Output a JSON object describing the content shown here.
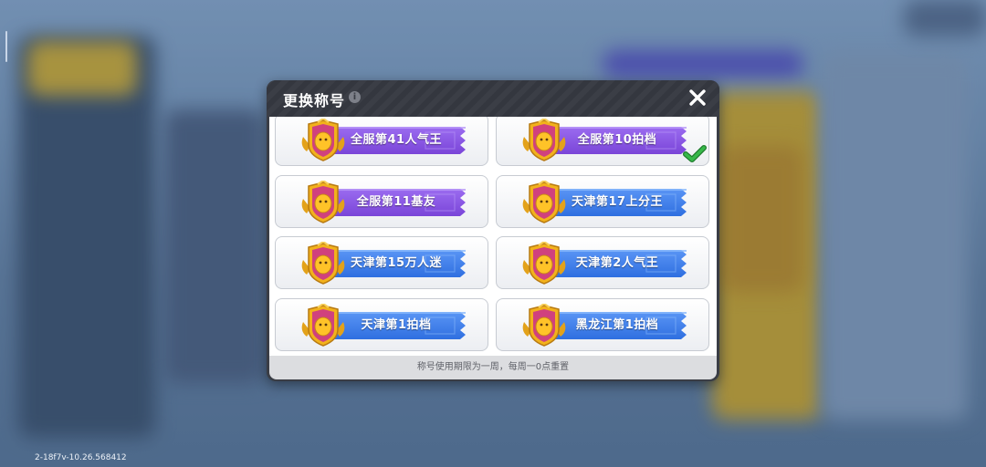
{
  "dialog": {
    "title": "更换称号",
    "footer_note": "称号使用期限为一周，每周一0点重置"
  },
  "titles": [
    {
      "label": "全服第41人气王",
      "style": "purple",
      "badge": "trophy-badge-icon",
      "selected": false
    },
    {
      "label": "全服第10拍档",
      "style": "purple",
      "badge": "ghost-duo-badge-icon",
      "selected": true
    },
    {
      "label": "全服第11基友",
      "style": "purple",
      "badge": "linked-rings-badge-icon",
      "selected": false
    },
    {
      "label": "天津第17上分王",
      "style": "blue",
      "badge": "crossed-swords-badge-icon",
      "selected": false
    },
    {
      "label": "天津第15万人迷",
      "style": "blue",
      "badge": "heart-fan-badge-icon",
      "selected": false
    },
    {
      "label": "天津第2人气王",
      "style": "blue",
      "badge": "trophy-badge-icon",
      "selected": false
    },
    {
      "label": "天津第1拍档",
      "style": "blue",
      "badge": "ghost-duo-badge-icon",
      "selected": false
    },
    {
      "label": "黑龙江第1拍档",
      "style": "blue",
      "badge": "ghost-duo-badge-icon",
      "selected": false
    }
  ],
  "colors": {
    "purple_banner": "#7a45d8",
    "blue_banner": "#2f6fe0",
    "badge_gold": "#f2b21c",
    "badge_pink": "#d0417e",
    "check_green": "#37b84a"
  },
  "build_version": "2-18f7v-10.26.568412"
}
